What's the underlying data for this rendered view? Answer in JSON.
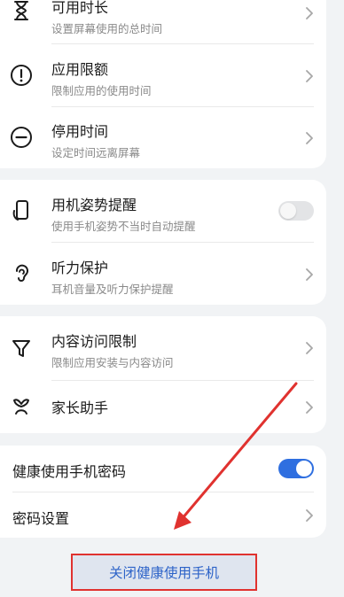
{
  "group1": {
    "items": [
      {
        "title": "可用时长",
        "subtitle": "设置屏幕使用的总时间",
        "icon": "hourglass-icon"
      },
      {
        "title": "应用限额",
        "subtitle": "限制应用的使用时间",
        "icon": "exclamation-circle-icon"
      },
      {
        "title": "停用时间",
        "subtitle": "设定时间远离屏幕",
        "icon": "minus-circle-icon"
      }
    ]
  },
  "group2": {
    "items": [
      {
        "title": "用机姿势提醒",
        "subtitle": "使用手机姿势不当时自动提醒",
        "icon": "phone-posture-icon",
        "toggle": false
      },
      {
        "title": "听力保护",
        "subtitle": "耳机音量及听力保护提醒",
        "icon": "ear-icon"
      }
    ]
  },
  "group3": {
    "items": [
      {
        "title": "内容访问限制",
        "subtitle": "限制应用安装与内容访问",
        "icon": "filter-icon"
      },
      {
        "title": "家长助手",
        "icon": "parent-assistant-icon"
      }
    ]
  },
  "group4": {
    "password_toggle_label": "健康使用手机密码",
    "password_toggle_on": true,
    "password_settings_label": "密码设置"
  },
  "close_button_label": "关闭健康使用手机",
  "colors": {
    "accent": "#2f6fe0",
    "highlight_red": "#e0322f",
    "button_text": "#2d63c8"
  }
}
